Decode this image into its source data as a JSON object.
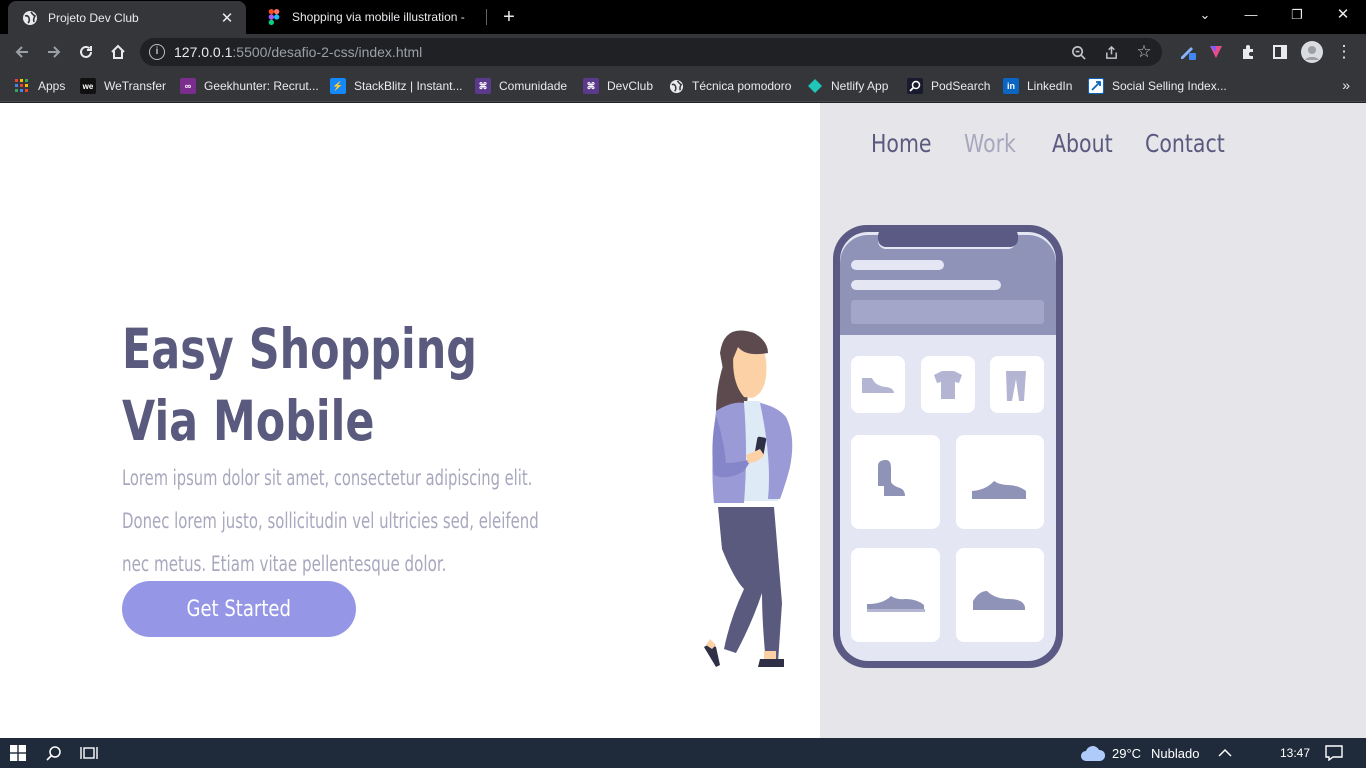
{
  "browser": {
    "tabs": [
      {
        "title": "Projeto Dev Club",
        "active": true,
        "favicon": "globe-icon"
      },
      {
        "title": "Shopping via mobile illustration -",
        "active": false,
        "favicon": "figma-icon"
      }
    ],
    "url_host": "127.0.0.1",
    "url_rest": ":5500/desafio-2-css/index.html",
    "bookmarks": [
      {
        "label": "Apps",
        "icon": "apps-grid-icon"
      },
      {
        "label": "WeTransfer",
        "icon": "wetransfer-icon"
      },
      {
        "label": "Geekhunter: Recrut...",
        "icon": "geekhunter-icon"
      },
      {
        "label": "StackBlitz | Instant...",
        "icon": "stackblitz-icon"
      },
      {
        "label": "Comunidade",
        "icon": "devclub-icon"
      },
      {
        "label": "DevClub",
        "icon": "devclub-icon"
      },
      {
        "label": "Técnica pomodoro",
        "icon": "globe-icon"
      },
      {
        "label": "Netlify App",
        "icon": "netlify-icon"
      },
      {
        "label": "PodSearch",
        "icon": "podsearch-icon"
      },
      {
        "label": "LinkedIn",
        "icon": "linkedin-icon"
      },
      {
        "label": "Social Selling Index...",
        "icon": "linkedin-ssi-icon"
      }
    ],
    "more_label": "»"
  },
  "site": {
    "nav": [
      {
        "label": "Home",
        "muted": false
      },
      {
        "label": "Work",
        "muted": true
      },
      {
        "label": "About",
        "muted": false
      },
      {
        "label": "Contact",
        "muted": false
      }
    ],
    "hero_title_line1": "Easy Shopping",
    "hero_title_line2": "Via Mobile",
    "hero_desc_line1": "Lorem ipsum dolor sit amet, consectetur adipiscing elit.",
    "hero_desc_line2": "Donec lorem justo, sollicitudin vel ultricies sed, eleifend",
    "hero_desc_line3": "nec metus. Etiam vitae pellentesque dolor.",
    "cta_label": "Get Started"
  },
  "taskbar": {
    "weather_temp": "29°C",
    "weather_text": "Nublado",
    "clock": "13:47"
  },
  "colors": {
    "accent": "#9597e6",
    "text_dark": "#5a5a7e",
    "text_muted": "#a8a8be",
    "panel_bg": "#e6e5ea"
  }
}
